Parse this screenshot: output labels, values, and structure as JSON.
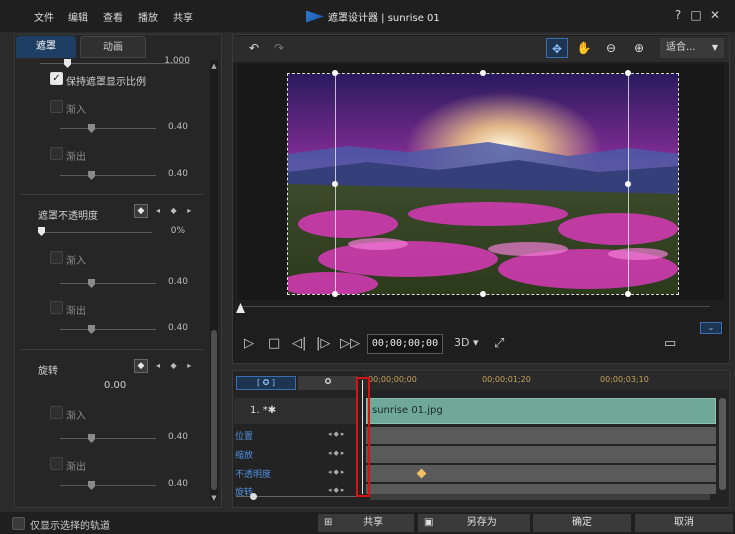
{
  "menu": [
    "文件",
    "编辑",
    "查看",
    "播放",
    "共享"
  ],
  "window": {
    "title": "遮罩设计器 | sunrise 01",
    "help": "?",
    "maximize": "□",
    "close": "✕"
  },
  "left_tabs": [
    "遮罩",
    "动画"
  ],
  "left_panel": {
    "top_value": "1.000",
    "keep_ratio_label": "保持遮罩显示比例",
    "fade_in_label": "渐入",
    "fade_out_label": "渐出",
    "fade_in_value_1": "0.40",
    "fade_out_value_1": "0.40",
    "opacity_section_label": "遮罩不透明度",
    "opacity_value": "0%",
    "fade_in_value_2": "0.40",
    "fade_out_value_2": "0.40",
    "rotate_section_label": "旋转",
    "rotate_value": "0.00",
    "fade_in_value_3": "0.40",
    "fade_out_value_3": "0.40"
  },
  "preview_toolbar": {
    "zoom_label": "适合..."
  },
  "playback": {
    "timecode": "00;00;00;00",
    "mode_3d": "3D"
  },
  "timeline": {
    "ruler": [
      "00;00;00;00",
      "00;00;01;20",
      "00;00;03;10"
    ],
    "track_name": "1. *",
    "clip_label": "sunrise 01.jpg",
    "attributes": [
      "位置",
      "缩放",
      "不透明度",
      "旋转"
    ]
  },
  "bottom": {
    "show_selected_label": "仅显示选择的轨道",
    "share_label": "共享",
    "save_as_label": "另存为",
    "ok_label": "确定",
    "cancel_label": "取消"
  }
}
